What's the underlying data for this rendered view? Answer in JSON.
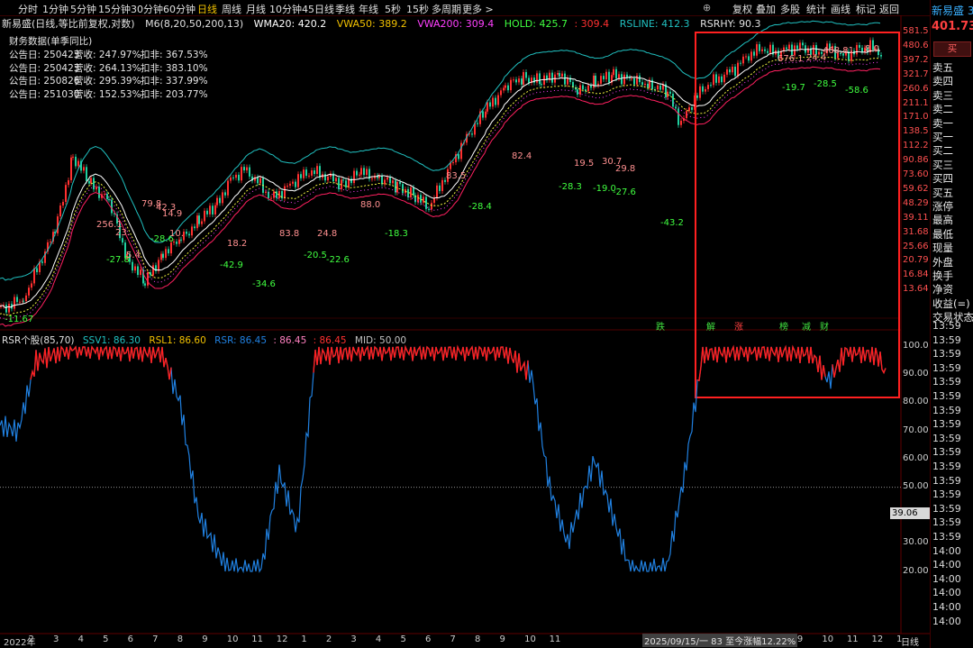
{
  "toolbar": {
    "timeframes": [
      "分时",
      "1分钟",
      "5分钟",
      "15分钟",
      "30分钟",
      "60分钟",
      "日线",
      "周线",
      "月线",
      "10分钟",
      "45日线",
      "季线",
      "年线",
      "5秒",
      "15秒",
      "多周期",
      "更多 >"
    ],
    "active": "日线",
    "right_buttons": [
      "复权",
      "叠加",
      "多股",
      "统计",
      "画线",
      "标记",
      "返回"
    ],
    "extra_icon": "⊕"
  },
  "indicator_line": {
    "name": "新易盛(日线,等比前复权,对数)",
    "ma": "M6(8,20,50,200,13)",
    "wma20": "WMA20: 420.2",
    "vwa50": "VWA50: 389.2",
    "vwa200": "VWA200: 309.4",
    "hold": "HOLD: 425.7",
    "hold2": ": 309.4",
    "rsline": "RSLINE: 412.3",
    "rsrhy": "RSRHY: 90.3"
  },
  "financial": {
    "title": "财务数据(单季同比)",
    "rows": [
      {
        "date": "公告日: 250423",
        "rev": "营收:  247.97%",
        "net": "扣非:  367.53%"
      },
      {
        "date": "公告日: 250423",
        "rev": "营收:  264.13%",
        "net": "扣非:  383.10%"
      },
      {
        "date": "公告日: 250826",
        "rev": "营收:  295.39%",
        "net": "扣非:  337.99%"
      },
      {
        "date": "公告日: 251030",
        "rev": "营收:  152.53%",
        "net": "扣非:  203.77%"
      }
    ]
  },
  "right_panel": {
    "stock_name": "新易盛 3",
    "price": "401.73",
    "buy_label": "买",
    "quote_labels": [
      "卖五",
      "卖四",
      "卖三",
      "卖二",
      "卖一",
      "买一",
      "买二",
      "买三",
      "买四",
      "买五",
      "涨停",
      "最高",
      "最低",
      "现量",
      "外盘",
      "换手",
      "净资",
      "收益(=)",
      "交易状态"
    ],
    "times": [
      "13:59",
      "13:59",
      "13:59",
      "13:59",
      "13:59",
      "13:59",
      "13:59",
      "13:59",
      "13:59",
      "13:59",
      "13:59",
      "13:59",
      "13:59",
      "13:59",
      "13:59",
      "13:59",
      "14:00",
      "14:00",
      "14:00",
      "14:00",
      "14:00",
      "14:00"
    ]
  },
  "price_axis": [
    "581.5",
    "480.6",
    "397.2",
    "321.7",
    "260.6",
    "211.1",
    "171.0",
    "138.5",
    "112.2",
    "90.86",
    "73.60",
    "59.62",
    "48.29",
    "39.11",
    "31.68",
    "25.66",
    "20.79",
    "16.84",
    "13.64"
  ],
  "rsr_axis": [
    "100.0",
    "90.00",
    "80.00",
    "70.00",
    "60.00",
    "50.00",
    "40.00",
    "30.00",
    "20.00"
  ],
  "rsr_current": "39.06",
  "rsr_header": {
    "name": "RSR个股(85,70)",
    "ssv1": "SSV1: 86.30",
    "rsl1": "RSL1: 86.60",
    "rsr": "RSR: 86.45",
    "v4": ": 86.45",
    "v5": ": 86.45",
    "mid": "MID: 50.00"
  },
  "x_axis": {
    "labels": [
      "2022年",
      "2",
      "3",
      "4",
      "5",
      "6",
      "7",
      "8",
      "9",
      "10",
      "11",
      "12",
      "1",
      "2",
      "3",
      "4",
      "5",
      "6",
      "7",
      "8",
      "9",
      "10",
      "11",
      "12",
      "1",
      "2",
      "3",
      "4",
      "5",
      "6",
      "7",
      "8",
      "9",
      "10",
      "11",
      "12",
      "1"
    ],
    "status": "2025/09/15/一 83 至今涨幅12.22%",
    "period": "日线"
  },
  "annotations": {
    "price_labels": [
      "-11.67",
      "256.1",
      "79.8",
      "42.3",
      "14.9",
      "23.",
      "-27.8",
      "5.4",
      "-28.6",
      "10.",
      "-42.9",
      "18.2",
      "-34.6",
      "83.8",
      "-20.5",
      "-22.6",
      "24.8",
      "88.0",
      "-18.3",
      "83.5",
      "-28.4",
      "82.4",
      "-28.3",
      "19.5",
      "-19.0",
      "30.7",
      "-27.6",
      "29.8",
      "-43.2",
      "-19.7",
      "676.1",
      "24.4",
      "468.81",
      "-28.5",
      "-58.6",
      "8.0"
    ],
    "event_markers": [
      "跌",
      "解",
      "涨",
      "榜",
      "减",
      "财"
    ]
  },
  "colors": {
    "up": "#ff3030",
    "down": "#20d0a0",
    "wma20": "#f0f040",
    "vwa50": "#f0c000",
    "vwa200": "#ff40ff",
    "hold": "#40ff40",
    "rsline": "#20c0c0",
    "rsr_red": "#ff2020",
    "rsr_blue": "#2080e0",
    "rsr_pink": "#ff80c0",
    "highlight_box": "#ff2020"
  },
  "chart_data": {
    "type": "line",
    "title": "新易盛(日线,等比前复权,对数)",
    "y_scale": "log",
    "ylim": [
      13.64,
      581.5
    ],
    "series": [
      {
        "name": "WMA20",
        "last": 420.2
      },
      {
        "name": "VWA50",
        "last": 389.2
      },
      {
        "name": "VWA200",
        "last": 309.4
      },
      {
        "name": "HOLD",
        "last": 425.7
      },
      {
        "name": "RSLINE",
        "last": 412.3
      }
    ],
    "sub_chart": {
      "type": "line",
      "title": "RSR个股(85,70)",
      "ylim": [
        20,
        100
      ],
      "series": [
        {
          "name": "SSV1",
          "last": 86.3
        },
        {
          "name": "RSL1",
          "last": 86.6
        },
        {
          "name": "RSR",
          "last": 86.45
        },
        {
          "name": "MID",
          "last": 50.0
        }
      ]
    }
  }
}
